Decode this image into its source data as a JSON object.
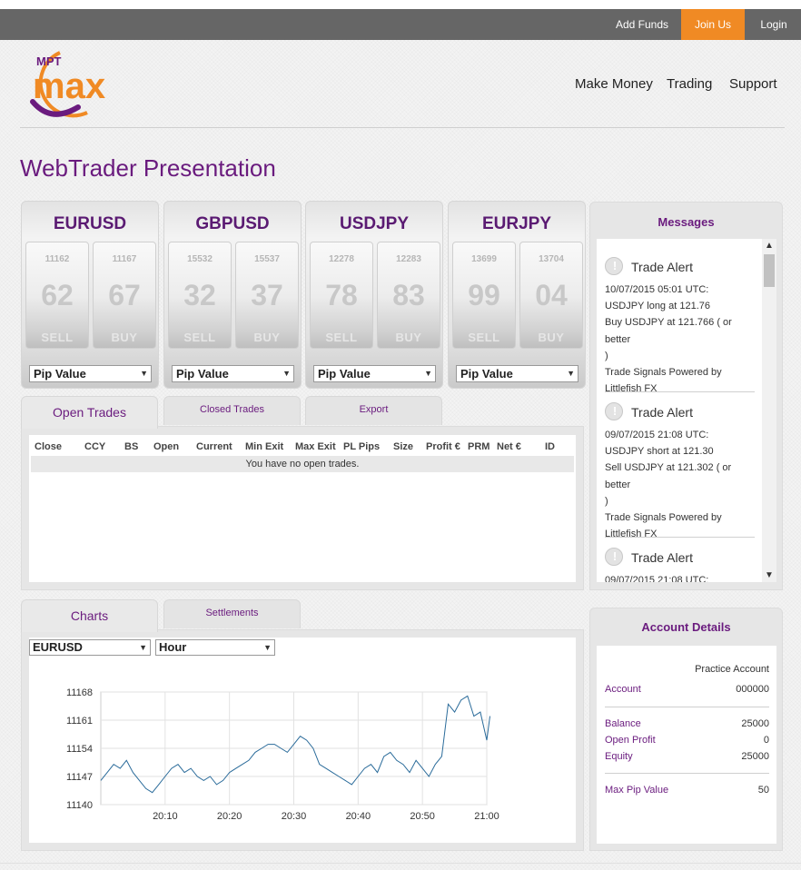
{
  "topbar": {
    "add_funds": "Add Funds",
    "join_us": "Join Us",
    "login": "Login"
  },
  "logo": {
    "text_small": "MPT",
    "text_big": "max"
  },
  "nav": {
    "make_money": "Make Money",
    "trading": "Trading",
    "support": "Support"
  },
  "page_title": "WebTrader Presentation",
  "quotes": [
    {
      "symbol": "EURUSD",
      "sell_small": "11162",
      "sell_big": "62",
      "buy_small": "11167",
      "buy_big": "67",
      "sell_label": "SELL",
      "buy_label": "BUY",
      "select": "Pip Value"
    },
    {
      "symbol": "GBPUSD",
      "sell_small": "15532",
      "sell_big": "32",
      "buy_small": "15537",
      "buy_big": "37",
      "sell_label": "SELL",
      "buy_label": "BUY",
      "select": "Pip Value"
    },
    {
      "symbol": "USDJPY",
      "sell_small": "12278",
      "sell_big": "78",
      "buy_small": "12283",
      "buy_big": "83",
      "sell_label": "SELL",
      "buy_label": "BUY",
      "select": "Pip Value"
    },
    {
      "symbol": "EURJPY",
      "sell_small": "13699",
      "sell_big": "99",
      "buy_small": "13704",
      "buy_big": "04",
      "sell_label": "SELL",
      "buy_label": "BUY",
      "select": "Pip Value"
    }
  ],
  "trade_tabs": {
    "open": "Open Trades",
    "closed": "Closed Trades",
    "export": "Export"
  },
  "trade_columns": [
    "Close",
    "CCY",
    "BS",
    "Open",
    "Current",
    "Min Exit",
    "Max Exit",
    "PL Pips",
    "Size",
    "Profit €",
    "PRM",
    "Net €",
    "ID"
  ],
  "no_trades": "You have no open trades.",
  "messages": {
    "title": "Messages",
    "items": [
      {
        "title": "Trade Alert",
        "lines": [
          "10/07/2015 05:01 UTC:",
          "USDJPY long at 121.76",
          "Buy USDJPY at 121.766 ( or better",
          ")",
          "Trade Signals Powered by",
          "Littlefish FX"
        ]
      },
      {
        "title": "Trade Alert",
        "lines": [
          "09/07/2015 21:08 UTC:",
          "USDJPY short at 121.30",
          "Sell USDJPY at 121.302 ( or better",
          ")",
          "Trade Signals Powered by",
          "Littlefish FX"
        ]
      },
      {
        "title": "Trade Alert",
        "lines": [
          "09/07/2015 21:08 UTC:"
        ]
      }
    ]
  },
  "chart_tabs": {
    "charts": "Charts",
    "settlements": "Settlements"
  },
  "chart_controls": {
    "symbol": "EURUSD",
    "interval": "Hour"
  },
  "account": {
    "title": "Account Details",
    "type": "Practice Account",
    "account_label": "Account",
    "account_value": "000000",
    "balance_label": "Balance",
    "balance_value": "25000",
    "open_profit_label": "Open Profit",
    "open_profit_value": "0",
    "equity_label": "Equity",
    "equity_value": "25000",
    "max_pip_label": "Max Pip Value",
    "max_pip_value": "50"
  },
  "colors": {
    "accent": "#6a1b7e",
    "join": "#f08a24",
    "topbar": "#666666",
    "line": "#2a6b9a"
  },
  "chart_data": {
    "type": "line",
    "xlabel": "",
    "ylabel": "",
    "x_ticks": [
      "20:10",
      "20:20",
      "20:30",
      "20:40",
      "20:50",
      "21:00"
    ],
    "y_ticks": [
      11140,
      11147,
      11154,
      11161,
      11168
    ],
    "xlim": [
      0,
      60
    ],
    "ylim": [
      11140,
      11168
    ],
    "grid": true,
    "series": [
      {
        "points": [
          [
            0,
            11146
          ],
          [
            1,
            11148
          ],
          [
            2,
            11150
          ],
          [
            3,
            11149
          ],
          [
            4,
            11151
          ],
          [
            5,
            11148
          ],
          [
            6,
            11146
          ],
          [
            7,
            11144
          ],
          [
            8,
            11143
          ],
          [
            9,
            11145
          ],
          [
            10,
            11147
          ],
          [
            11,
            11149
          ],
          [
            12,
            11150
          ],
          [
            13,
            11148
          ],
          [
            14,
            11149
          ],
          [
            15,
            11147
          ],
          [
            16,
            11146
          ],
          [
            17,
            11147
          ],
          [
            18,
            11145
          ],
          [
            19,
            11146
          ],
          [
            20,
            11148
          ],
          [
            21,
            11149
          ],
          [
            22,
            11150
          ],
          [
            23,
            11151
          ],
          [
            24,
            11153
          ],
          [
            25,
            11154
          ],
          [
            26,
            11155
          ],
          [
            27,
            11155
          ],
          [
            28,
            11154
          ],
          [
            29,
            11153
          ],
          [
            30,
            11155
          ],
          [
            31,
            11157
          ],
          [
            32,
            11156
          ],
          [
            33,
            11154
          ],
          [
            34,
            11150
          ],
          [
            35,
            11149
          ],
          [
            36,
            11148
          ],
          [
            37,
            11147
          ],
          [
            38,
            11146
          ],
          [
            39,
            11145
          ],
          [
            40,
            11147
          ],
          [
            41,
            11149
          ],
          [
            42,
            11150
          ],
          [
            43,
            11148
          ],
          [
            44,
            11152
          ],
          [
            45,
            11153
          ],
          [
            46,
            11151
          ],
          [
            47,
            11150
          ],
          [
            48,
            11148
          ],
          [
            49,
            11151
          ],
          [
            50,
            11149
          ],
          [
            51,
            11147
          ],
          [
            52,
            11150
          ],
          [
            53,
            11152
          ],
          [
            54,
            11165
          ],
          [
            55,
            11163
          ],
          [
            56,
            11166
          ],
          [
            57,
            11167
          ],
          [
            58,
            11162
          ],
          [
            59,
            11163
          ],
          [
            60,
            11156
          ],
          [
            60.5,
            11162
          ]
        ]
      }
    ]
  }
}
